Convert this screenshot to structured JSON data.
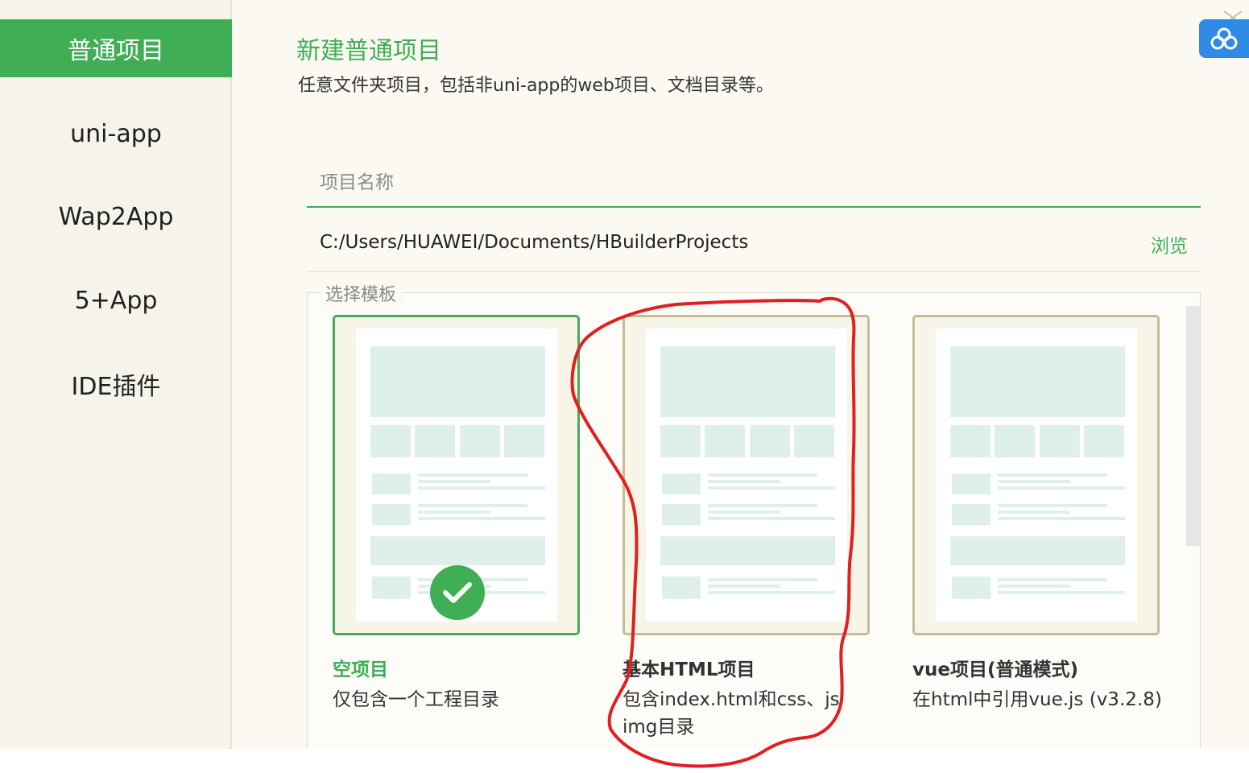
{
  "sidebar": {
    "items": [
      {
        "label": "普通项目",
        "active": true
      },
      {
        "label": "uni-app",
        "active": false
      },
      {
        "label": "Wap2App",
        "active": false
      },
      {
        "label": "5+App",
        "active": false
      },
      {
        "label": "IDE插件",
        "active": false
      }
    ]
  },
  "main": {
    "title": "新建普通项目",
    "description": "任意文件夹项目，包括非uni-app的web项目、文档目录等。",
    "project_name": {
      "value": "",
      "placeholder": "项目名称"
    },
    "location": {
      "path": "C:/Users/HUAWEI/Documents/HBuilderProjects",
      "browse_label": "浏览"
    },
    "template_section_label": "选择模板",
    "templates": [
      {
        "title": "空项目",
        "description": "仅包含一个工程目录",
        "selected": true
      },
      {
        "title": "基本HTML项目",
        "description": "包含index.html和css、js img目录",
        "selected": false
      },
      {
        "title": "vue项目(普通模式)",
        "description": "在html中引用vue.js (v3.2.8)",
        "selected": false
      }
    ]
  },
  "widgets": {
    "cloud_icon": "cloud-sync-icon",
    "close_icon": "close-icon"
  },
  "colors": {
    "accent": "#3fae55",
    "card_border": "#c8bc96",
    "annotation": "#e02020",
    "widget_blue": "#2f8ae6"
  }
}
